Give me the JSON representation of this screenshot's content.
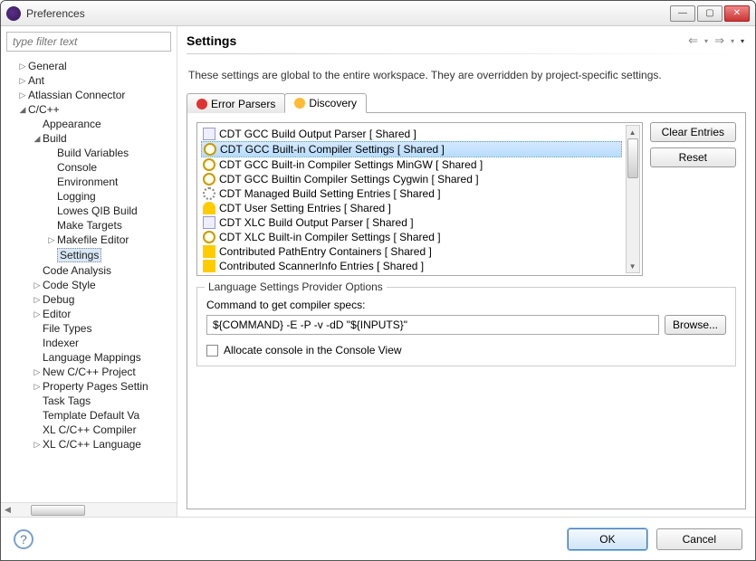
{
  "window": {
    "title": "Preferences"
  },
  "sidebar": {
    "filter_placeholder": "type filter text",
    "items": [
      {
        "label": "General",
        "depth": 1,
        "arrow": "▷"
      },
      {
        "label": "Ant",
        "depth": 1,
        "arrow": "▷"
      },
      {
        "label": "Atlassian Connector",
        "depth": 1,
        "arrow": "▷"
      },
      {
        "label": "C/C++",
        "depth": 1,
        "arrow": "◢"
      },
      {
        "label": "Appearance",
        "depth": 2,
        "arrow": ""
      },
      {
        "label": "Build",
        "depth": 2,
        "arrow": "◢"
      },
      {
        "label": "Build Variables",
        "depth": 3,
        "arrow": ""
      },
      {
        "label": "Console",
        "depth": 3,
        "arrow": ""
      },
      {
        "label": "Environment",
        "depth": 3,
        "arrow": ""
      },
      {
        "label": "Logging",
        "depth": 3,
        "arrow": ""
      },
      {
        "label": "Lowes QIB Build",
        "depth": 3,
        "arrow": ""
      },
      {
        "label": "Make Targets",
        "depth": 3,
        "arrow": ""
      },
      {
        "label": "Makefile Editor",
        "depth": 3,
        "arrow": "▷"
      },
      {
        "label": "Settings",
        "depth": 3,
        "arrow": "",
        "selected": true
      },
      {
        "label": "Code Analysis",
        "depth": 2,
        "arrow": ""
      },
      {
        "label": "Code Style",
        "depth": 2,
        "arrow": "▷"
      },
      {
        "label": "Debug",
        "depth": 2,
        "arrow": "▷"
      },
      {
        "label": "Editor",
        "depth": 2,
        "arrow": "▷"
      },
      {
        "label": "File Types",
        "depth": 2,
        "arrow": ""
      },
      {
        "label": "Indexer",
        "depth": 2,
        "arrow": ""
      },
      {
        "label": "Language Mappings",
        "depth": 2,
        "arrow": ""
      },
      {
        "label": "New C/C++ Project",
        "depth": 2,
        "arrow": "▷"
      },
      {
        "label": "Property Pages Settin",
        "depth": 2,
        "arrow": "▷"
      },
      {
        "label": "Task Tags",
        "depth": 2,
        "arrow": ""
      },
      {
        "label": "Template Default Va",
        "depth": 2,
        "arrow": ""
      },
      {
        "label": "XL C/C++ Compiler",
        "depth": 2,
        "arrow": ""
      },
      {
        "label": "XL C/C++ Language",
        "depth": 2,
        "arrow": "▷"
      }
    ]
  },
  "page": {
    "title": "Settings",
    "description": "These settings are global to the entire workspace.  They are overridden by project-specific settings.",
    "tabs": [
      {
        "label": "Error Parsers",
        "icon": "red"
      },
      {
        "label": "Discovery",
        "icon": "yel",
        "active": true
      }
    ],
    "providers": [
      {
        "label": "CDT GCC Build Output Parser   [ Shared ]",
        "icon": "doc"
      },
      {
        "label": "CDT GCC Built-in Compiler Settings   [ Shared ]",
        "icon": "mag",
        "selected": true
      },
      {
        "label": "CDT GCC Built-in Compiler Settings MinGW   [ Shared ]",
        "icon": "mag"
      },
      {
        "label": "CDT GCC Builtin Compiler Settings Cygwin   [ Shared ]",
        "icon": "mag"
      },
      {
        "label": "CDT Managed Build Setting Entries   [ Shared ]",
        "icon": "cog"
      },
      {
        "label": "CDT User Setting Entries   [ Shared ]",
        "icon": "user"
      },
      {
        "label": "CDT XLC Build Output Parser   [ Shared ]",
        "icon": "doc"
      },
      {
        "label": "CDT XLC Built-in Compiler Settings   [ Shared ]",
        "icon": "mag"
      },
      {
        "label": "Contributed PathEntry Containers   [ Shared ]",
        "icon": "key"
      },
      {
        "label": "Contributed ScannerInfo Entries   [ Shared ]",
        "icon": "key"
      }
    ],
    "side_buttons": {
      "clear": "Clear Entries",
      "reset": "Reset"
    },
    "options": {
      "legend": "Language Settings Provider Options",
      "command_label": "Command to get compiler specs:",
      "command_value": "${COMMAND} -E -P -v -dD \"${INPUTS}\"",
      "browse": "Browse...",
      "allocate_console": "Allocate console in the Console View"
    }
  },
  "footer": {
    "ok": "OK",
    "cancel": "Cancel"
  }
}
